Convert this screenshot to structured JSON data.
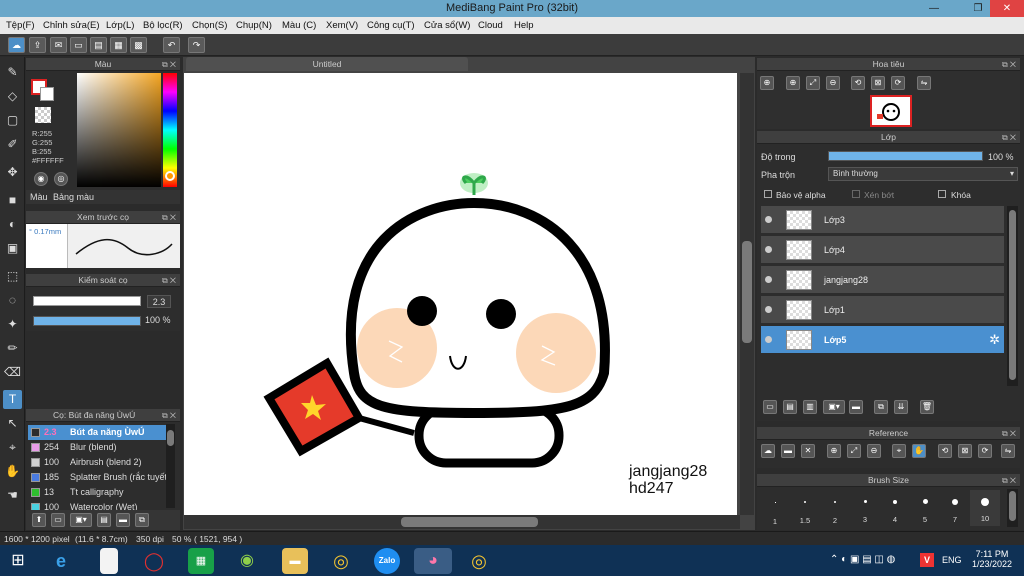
{
  "window": {
    "title": "MediBang Paint Pro (32bit)"
  },
  "menu": [
    "Tệp(F)",
    "Chỉnh sửa(E)",
    "Lớp(L)",
    "Bộ lọc(R)",
    "Chọn(S)",
    "Chụp(N)",
    "Màu (C)",
    "Xem(V)",
    "Công cụ(T)",
    "Cửa sổ(W)",
    "Cloud",
    "Help"
  ],
  "color_panel": {
    "title": "Màu",
    "r": "R:255",
    "g": "G:255",
    "b": "B:255",
    "hex": "#FFFFFF",
    "tab1": "Màu",
    "tab2": "Bảng màu"
  },
  "brush_preview": {
    "title": "Xem trước cọ",
    "size": "0.17mm"
  },
  "brush_control": {
    "title": "Kiểm soát cọ",
    "size": "2.3",
    "opacity": "100 %",
    "size_fraction": 1.0,
    "opacity_fraction": 1.0
  },
  "brush_list": {
    "title": "Cọ: Bút đa năng ÙwÚ",
    "items": [
      {
        "size": "2.3",
        "name": "Bút đa năng ÙwÚ",
        "color": "#ff4ea6",
        "selected": true
      },
      {
        "size": "254",
        "name": "Blur (blend)",
        "color": "#e89ce8"
      },
      {
        "size": "100",
        "name": "Airbrush (blend 2)",
        "color": "#d0d0d0"
      },
      {
        "size": "185",
        "name": "Splatter Brush (rắc tuyết)",
        "color": "#4a7be0"
      },
      {
        "size": "13",
        "name": "Tt calligraphy",
        "color": "#2fbf2f"
      },
      {
        "size": "100",
        "name": "Watercolor (Wet)",
        "color": "#4ad0e0"
      }
    ]
  },
  "canvas": {
    "tab": "Untitled",
    "signature_line1": "jangjang28",
    "signature_line2": "hd247"
  },
  "navigator": {
    "title": "Hoa tiêu"
  },
  "layer_panel": {
    "title": "Lớp",
    "opacity_label": "Độ trong",
    "opacity_value": "100 %",
    "opacity_fraction": 1.0,
    "blend_label": "Pha trộn",
    "blend_value": "Bình thường",
    "protect_alpha": "Bảo vệ alpha",
    "clipping": "Xén bớt",
    "lock": "Khóa",
    "layers": [
      {
        "name": "Lớp3",
        "selected": false
      },
      {
        "name": "Lớp4",
        "selected": false
      },
      {
        "name": "jangjang28",
        "selected": false
      },
      {
        "name": "Lớp1",
        "selected": false
      },
      {
        "name": "Lớp5",
        "selected": true
      }
    ]
  },
  "reference": {
    "title": "Reference"
  },
  "brush_size_panel": {
    "title": "Brush Size",
    "sizes": [
      "1",
      "1.5",
      "2",
      "3",
      "4",
      "5",
      "7",
      "10"
    ]
  },
  "status": {
    "dimensions": "1600 * 1200 pixel",
    "physical": "(11.6 * 8.7cm)",
    "dpi": "350 dpi",
    "zoom": "50 %",
    "coords": "( 1521, 954 )"
  },
  "taskbar": {
    "lang": "ENG",
    "time": "7:11 PM",
    "date": "1/23/2022",
    "zalo": "Zalo"
  }
}
